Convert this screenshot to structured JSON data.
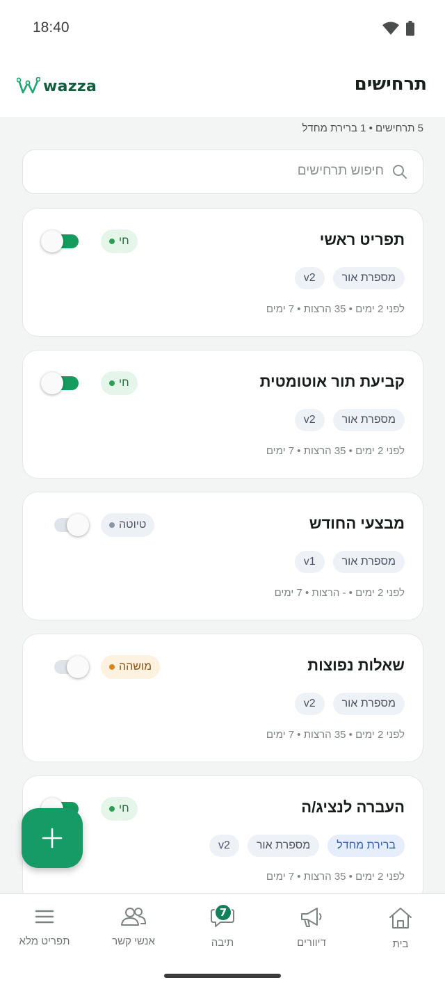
{
  "status_bar": {
    "time": "18:40"
  },
  "header": {
    "title": "תרחישים",
    "logo_text": "wazza"
  },
  "summary": "5 תרחישים • 1 ברירת מחדל",
  "search": {
    "placeholder": "חיפוש תרחישים"
  },
  "scenarios": [
    {
      "title": "תפריט ראשי",
      "status": "חי",
      "status_type": "live",
      "enabled": true,
      "tags": [
        "מספרת אור",
        "v2"
      ],
      "meta": "לפני 2 ימים • 35 הרצות • 7 ימים"
    },
    {
      "title": "קביעת תור אוטומטית",
      "status": "חי",
      "status_type": "live",
      "enabled": true,
      "tags": [
        "מספרת אור",
        "v2"
      ],
      "meta": "לפני 2 ימים • 35 הרצות • 7 ימים"
    },
    {
      "title": "מבצעי החודש",
      "status": "טיוטה",
      "status_type": "draft",
      "enabled": false,
      "tags": [
        "מספרת אור",
        "v1"
      ],
      "meta": "לפני 2 ימים • - הרצות • 7 ימים"
    },
    {
      "title": "שאלות נפוצות",
      "status": "מושהה",
      "status_type": "paused",
      "enabled": false,
      "tags": [
        "מספרת אור",
        "v2"
      ],
      "meta": "לפני 2 ימים • 35 הרצות • 7 ימים"
    },
    {
      "title": "העברה לנציג/ה",
      "status": "חי",
      "status_type": "live",
      "enabled": true,
      "tags": [
        "ברירת מחדל",
        "מספרת אור",
        "v2"
      ],
      "meta": "לפני 2 ימים • 35 הרצות • 7 ימים"
    }
  ],
  "fab": {
    "icon": "plus-icon"
  },
  "bottom_nav": {
    "home": "בית",
    "broadcasts": "דיוורים",
    "inbox": "תיבה",
    "inbox_badge": "7",
    "contacts": "אנשי קשר",
    "menu": "תפריט מלא"
  },
  "colors": {
    "brand": "#169b67",
    "live": "#2e9e55",
    "paused": "#d9861c",
    "draft": "#8c95a6"
  }
}
